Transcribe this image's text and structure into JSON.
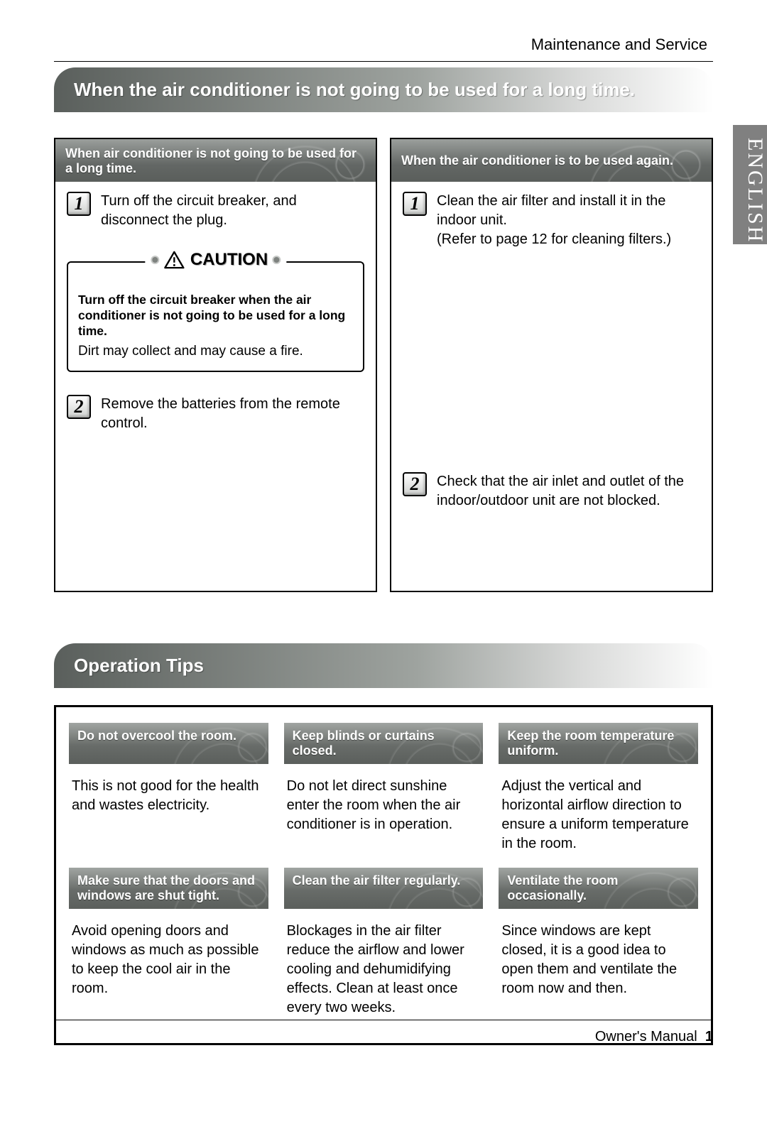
{
  "header": {
    "section": "Maintenance and Service"
  },
  "lang_tab": "ENGLISH",
  "banner1": "When the air conditioner is not going to be used for a long time.",
  "left_panel": {
    "title": "When air conditioner is not going to be used for a long time.",
    "step1_num": "1",
    "step1": "Turn off the circuit breaker, and disconnect the plug.",
    "caution": {
      "label": "CAUTION",
      "bold": "Turn off the circuit breaker when the air conditioner is not going to be used for a long time.",
      "body": "Dirt may collect and may cause a fire."
    },
    "step2_num": "2",
    "step2": "Remove the batteries from the remote control."
  },
  "right_panel": {
    "title": "When the air conditioner is to be used again.",
    "step1_num": "1",
    "step1a": "Clean the air filter and install it in the indoor unit.",
    "step1b": "(Refer to page 12 for cleaning filters.)",
    "step2_num": "2",
    "step2": "Check that the air inlet and outlet of the indoor/outdoor unit are not blocked."
  },
  "banner2": "Operation Tips",
  "tips": [
    {
      "title": "Do not overcool the room.",
      "body": "This is not good for the health and wastes electricity."
    },
    {
      "title": "Keep blinds or curtains closed.",
      "body": "Do not let direct sunshine enter the room when the air conditioner is in operation."
    },
    {
      "title": "Keep the room temperature uniform.",
      "body": "Adjust the vertical and horizontal airflow direction to ensure a uniform temperature in the room."
    },
    {
      "title": "Make sure that the doors and windows are shut tight.",
      "body": "Avoid opening doors and windows as much as possible to keep the cool air in the room."
    },
    {
      "title": "Clean the air filter regularly.",
      "body": "Blockages in the air filter reduce the airflow and lower cooling and dehumidifying effects. Clean at least once every two weeks."
    },
    {
      "title": "Ventilate the room occasionally.",
      "body": "Since windows are kept closed, it is a good idea to open them and ventilate the room now and then."
    }
  ],
  "footer": {
    "label": "Owner's Manual",
    "page": "1"
  }
}
